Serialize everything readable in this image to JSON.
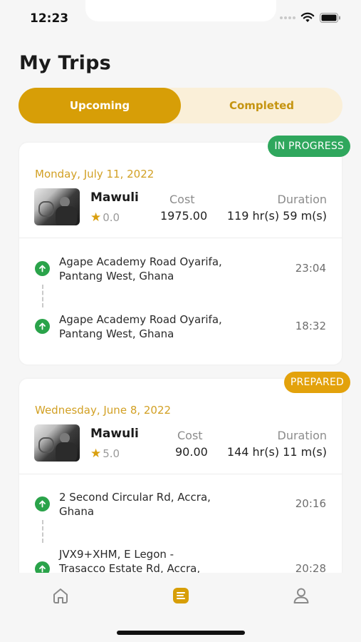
{
  "status": {
    "time": "12:23"
  },
  "page": {
    "title": "My Trips"
  },
  "tabs": [
    {
      "label": "Upcoming",
      "active": true
    },
    {
      "label": "Completed",
      "active": false
    }
  ],
  "trips": [
    {
      "status": "IN PROGRESS",
      "status_color": "#2fa75d",
      "date": "Monday, July 11, 2022",
      "driver": "Mawuli",
      "rating": "0.0",
      "cost_label": "Cost",
      "cost": "1975.00",
      "duration_label": "Duration",
      "duration": "119 hr(s) 59 m(s)",
      "stops": [
        {
          "line1": "Agape Academy Road Oyarifa,",
          "line2": "Pantang West, Ghana",
          "time": "23:04"
        },
        {
          "line1": "Agape Academy Road Oyarifa,",
          "line2": "Pantang West, Ghana",
          "time": "18:32"
        }
      ]
    },
    {
      "status": "PREPARED",
      "status_color": "#e3a20c",
      "date": "Wednesday, June 8, 2022",
      "driver": "Mawuli",
      "rating": "5.0",
      "cost_label": "Cost",
      "cost": "90.00",
      "duration_label": "Duration",
      "duration": "144 hr(s) 11 m(s)",
      "stops": [
        {
          "line1": "2 Second Circular Rd, Accra,",
          "line2": "Ghana",
          "time": "20:16"
        },
        {
          "line1": "JVX9+XHM, E Legon -",
          "line2": "Trasacco Estate Rd, Accra,",
          "time": "20:28"
        }
      ]
    }
  ],
  "nav": {
    "items": [
      {
        "icon": "home-icon",
        "active": false
      },
      {
        "icon": "trips-icon",
        "active": true
      },
      {
        "icon": "profile-icon",
        "active": false
      }
    ],
    "active_color": "#d79e07",
    "inactive_color": "#8a8a8a"
  }
}
